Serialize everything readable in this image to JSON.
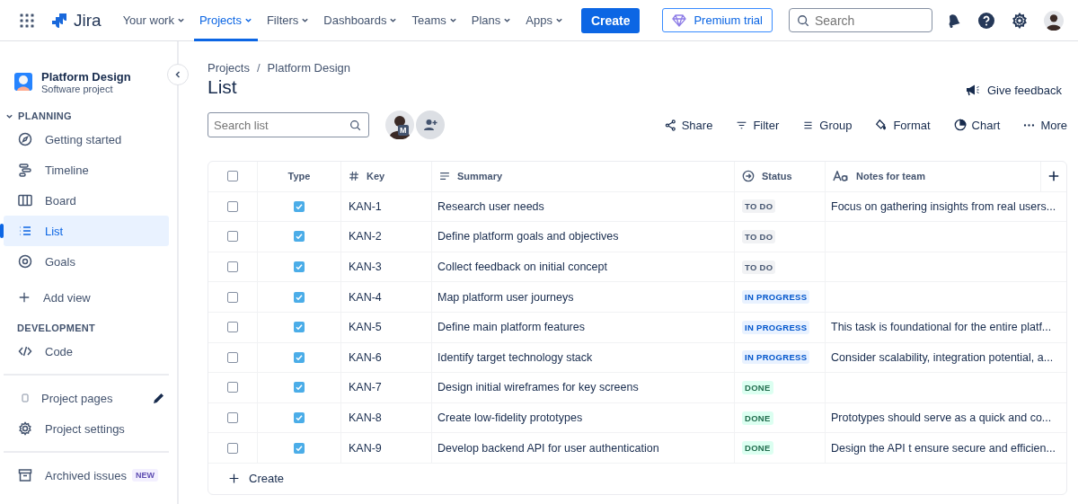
{
  "topbar": {
    "logo": "Jira",
    "nav": [
      {
        "label": "Your work",
        "selected": false
      },
      {
        "label": "Projects",
        "selected": true
      },
      {
        "label": "Filters",
        "selected": false
      },
      {
        "label": "Dashboards",
        "selected": false
      },
      {
        "label": "Teams",
        "selected": false
      },
      {
        "label": "Plans",
        "selected": false
      },
      {
        "label": "Apps",
        "selected": false
      }
    ],
    "create": "Create",
    "premium": "Premium trial",
    "search": {
      "placeholder": "Search"
    }
  },
  "sidebar": {
    "project": {
      "name": "Platform Design",
      "type": "Software project"
    },
    "sections": [
      {
        "title": "PLANNING",
        "expanded": true,
        "items": [
          {
            "label": "Getting started",
            "selected": false
          },
          {
            "label": "Timeline",
            "selected": false
          },
          {
            "label": "Board",
            "selected": false
          },
          {
            "label": "List",
            "selected": true
          },
          {
            "label": "Goals",
            "selected": false
          }
        ],
        "add": "Add view"
      },
      {
        "title": "DEVELOPMENT",
        "items": [
          {
            "label": "Code",
            "selected": false
          }
        ]
      }
    ],
    "footer": [
      {
        "label": "Project pages",
        "kind": "pages"
      },
      {
        "label": "Project settings",
        "kind": "settings"
      },
      {
        "label": "Archived issues",
        "kind": "archive",
        "badge": "NEW"
      }
    ]
  },
  "breadcrumbs": [
    "Projects",
    "Platform Design"
  ],
  "breadcrumb_separator": "/",
  "title": "List",
  "feedback": "Give feedback",
  "list_search": {
    "placeholder": "Search list"
  },
  "avatar_badge": "M",
  "actions": [
    "Share",
    "Filter",
    "Group",
    "Format",
    "Chart",
    "More"
  ],
  "table": {
    "columns": [
      "Type",
      "Key",
      "Summary",
      "Status",
      "Notes for team"
    ],
    "all_selected": false,
    "rows": [
      {
        "selected": false,
        "key": "KAN-1",
        "summary": "Research user needs",
        "status": {
          "label": "TO DO",
          "kind": "todo"
        },
        "notes": "Focus on gathering insights from real users..."
      },
      {
        "selected": false,
        "key": "KAN-2",
        "summary": "Define platform goals and objectives",
        "status": {
          "label": "TO DO",
          "kind": "todo"
        }
      },
      {
        "selected": false,
        "key": "KAN-3",
        "summary": "Collect feedback on initial concept",
        "status": {
          "label": "TO DO",
          "kind": "todo"
        }
      },
      {
        "selected": false,
        "key": "KAN-4",
        "summary": "Map platform user journeys",
        "status": {
          "label": "IN PROGRESS",
          "kind": "progress"
        }
      },
      {
        "selected": false,
        "key": "KAN-5",
        "summary": "Define main platform features",
        "status": {
          "label": "IN PROGRESS",
          "kind": "progress"
        },
        "notes": "This task is foundational for the entire platf..."
      },
      {
        "selected": false,
        "key": "KAN-6",
        "summary": "Identify target technology stack",
        "status": {
          "label": "IN PROGRESS",
          "kind": "progress"
        },
        "notes": "Consider scalability, integration potential, a..."
      },
      {
        "selected": false,
        "key": "KAN-7",
        "summary": "Design initial wireframes for key screens",
        "status": {
          "label": "DONE",
          "kind": "done"
        }
      },
      {
        "selected": false,
        "key": "KAN-8",
        "summary": "Create low-fidelity prototypes",
        "status": {
          "label": "DONE",
          "kind": "done"
        },
        "notes": "Prototypes should serve as a quick and co..."
      },
      {
        "selected": false,
        "key": "KAN-9",
        "summary": "Develop backend API for user authentication",
        "status": {
          "label": "DONE",
          "kind": "done"
        },
        "notes": "Design the API t ensure secure and efficien..."
      }
    ],
    "create": "Create"
  }
}
